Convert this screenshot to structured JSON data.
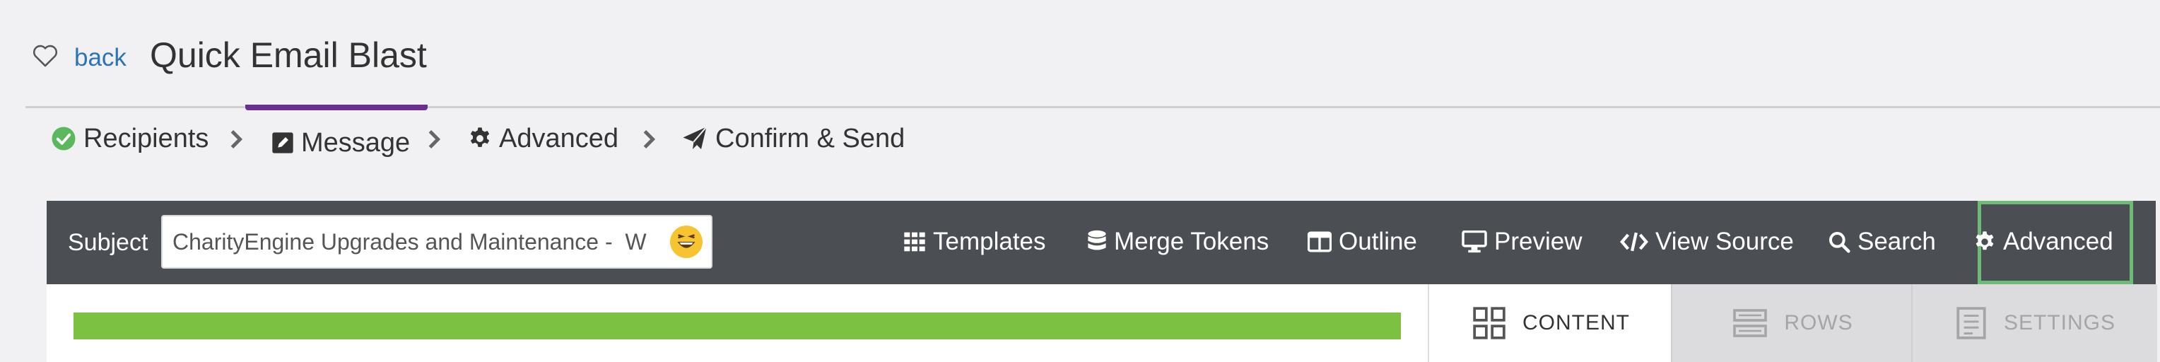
{
  "header": {
    "back_label": "back",
    "title": "Quick Email Blast"
  },
  "steps": [
    {
      "label": "Recipients",
      "icon": "check-circle-icon",
      "status": "complete",
      "icon_color": "#5cb85c"
    },
    {
      "label": "Message",
      "icon": "edit-icon",
      "status": "active",
      "active_color": "#6a2f8f"
    },
    {
      "label": "Advanced",
      "icon": "gear-icon",
      "status": "pending"
    },
    {
      "label": "Confirm & Send",
      "icon": "paper-plane-icon",
      "status": "pending"
    }
  ],
  "toolbar": {
    "subject_label": "Subject",
    "subject_value": "CharityEngine Upgrades and Maintenance -  W",
    "items": [
      {
        "label": "Templates",
        "icon": "grid-icon"
      },
      {
        "label": "Merge Tokens",
        "icon": "database-icon"
      },
      {
        "label": "Outline",
        "icon": "columns-icon"
      },
      {
        "label": "Preview",
        "icon": "monitor-icon"
      },
      {
        "label": "View Source",
        "icon": "code-icon"
      },
      {
        "label": "Search",
        "icon": "search-icon"
      },
      {
        "label": "Advanced",
        "icon": "gear-icon",
        "highlighted": true
      }
    ],
    "background": "#4b4f54",
    "highlight_color": "#6dbb76"
  },
  "panel_tabs": [
    {
      "label": "CONTENT",
      "icon": "content-grid-icon",
      "active": true
    },
    {
      "label": "ROWS",
      "icon": "rows-icon",
      "active": false
    },
    {
      "label": "SETTINGS",
      "icon": "settings-doc-icon",
      "active": false
    }
  ],
  "colors": {
    "link": "#2b74b8",
    "progress_bar": "#7dc142"
  }
}
